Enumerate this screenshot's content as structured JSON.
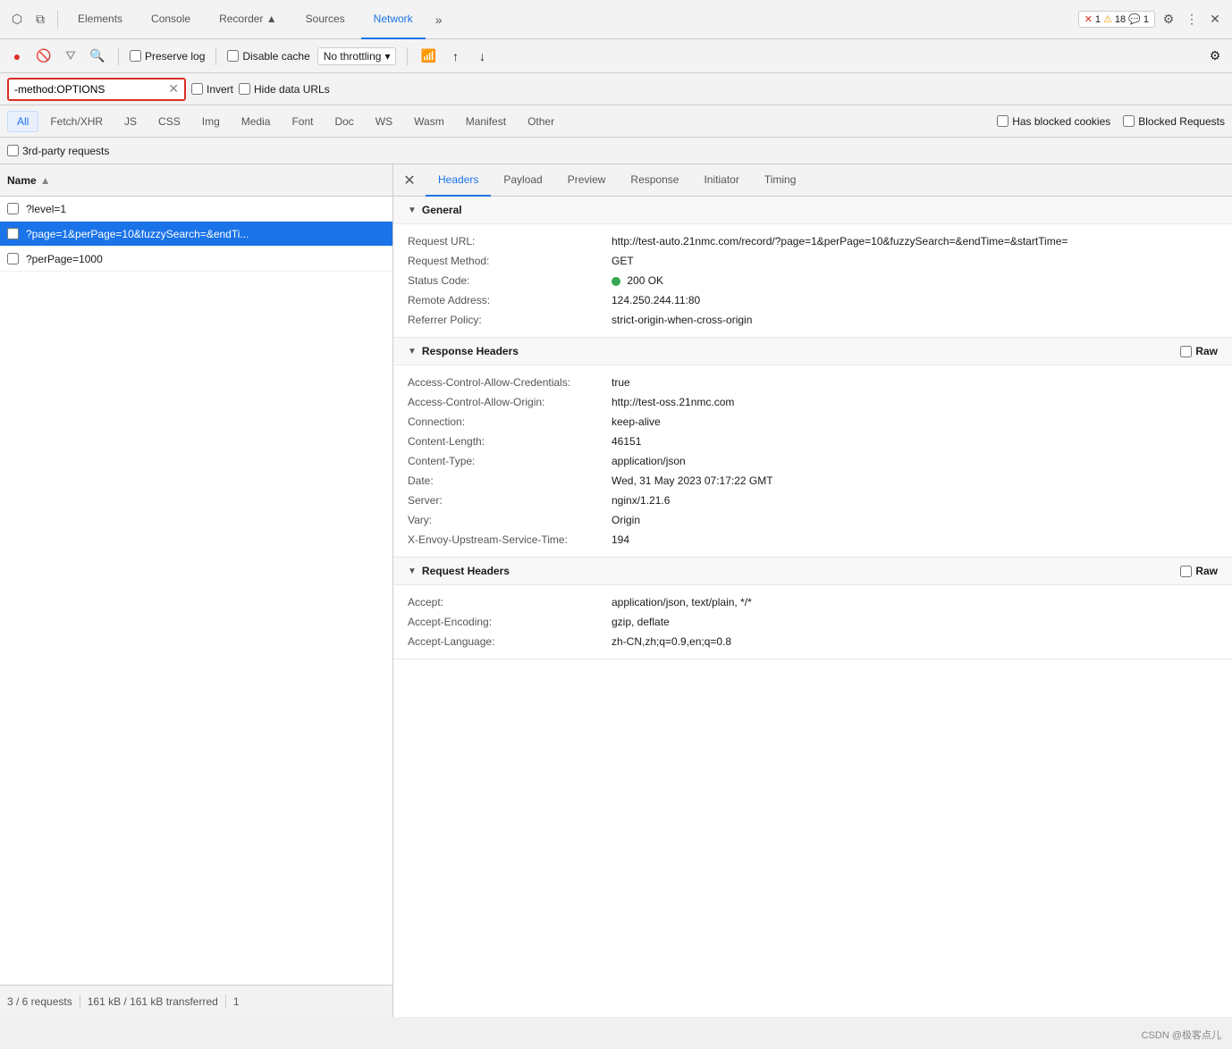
{
  "topbar": {
    "tabs": [
      {
        "label": "Elements",
        "active": false
      },
      {
        "label": "Console",
        "active": false
      },
      {
        "label": "Recorder ▲",
        "active": false
      },
      {
        "label": "Sources",
        "active": false
      },
      {
        "label": "Network",
        "active": true
      }
    ],
    "more_label": "»",
    "error_count": "1",
    "warn_count": "18",
    "info_count": "1",
    "settings_icon": "⚙",
    "more_icon": "⋮",
    "close_icon": "✕"
  },
  "toolbar": {
    "record_icon": "●",
    "clear_icon": "🚫",
    "filter_icon": "▼",
    "search_icon": "🔍",
    "preserve_log_label": "Preserve log",
    "disable_cache_label": "Disable cache",
    "throttle_label": "No throttling",
    "wifi_icon": "wifi",
    "upload_icon": "↑",
    "download_icon": "↓",
    "settings_icon": "⚙"
  },
  "filterbar": {
    "search_value": "-method:OPTIONS",
    "invert_label": "Invert",
    "hide_data_urls_label": "Hide data URLs"
  },
  "filter_tabs": [
    {
      "label": "All",
      "active": true
    },
    {
      "label": "Fetch/XHR",
      "active": false
    },
    {
      "label": "JS",
      "active": false
    },
    {
      "label": "CSS",
      "active": false
    },
    {
      "label": "Img",
      "active": false
    },
    {
      "label": "Media",
      "active": false
    },
    {
      "label": "Font",
      "active": false
    },
    {
      "label": "Doc",
      "active": false
    },
    {
      "label": "WS",
      "active": false
    },
    {
      "label": "Wasm",
      "active": false
    },
    {
      "label": "Manifest",
      "active": false
    },
    {
      "label": "Other",
      "active": false
    }
  ],
  "filter_checkboxes": [
    {
      "label": "Has blocked cookies"
    },
    {
      "label": "Blocked Requests"
    }
  ],
  "third_party_label": "3rd-party requests",
  "name_column": "Name",
  "requests": [
    {
      "name": "?level=1",
      "selected": false
    },
    {
      "name": "?page=1&perPage=10&fuzzySearch=&endTi...",
      "selected": true
    },
    {
      "name": "?perPage=1000",
      "selected": false
    }
  ],
  "status_bar": {
    "count": "3 / 6 requests",
    "size": "161 kB / 161 kB transferred",
    "page": "1"
  },
  "panel_tabs": [
    {
      "label": "Headers",
      "active": true
    },
    {
      "label": "Payload",
      "active": false
    },
    {
      "label": "Preview",
      "active": false
    },
    {
      "label": "Response",
      "active": false
    },
    {
      "label": "Initiator",
      "active": false
    },
    {
      "label": "Timing",
      "active": false
    }
  ],
  "sections": {
    "general": {
      "title": "General",
      "fields": [
        {
          "label": "Request URL:",
          "value": "http://test-auto.21nmc.com/record/?page=1&perPage=10&fuzzySearch=&endTime=&startTime="
        },
        {
          "label": "Request Method:",
          "value": "GET"
        },
        {
          "label": "Status Code:",
          "value": "200 OK",
          "has_dot": true
        },
        {
          "label": "Remote Address:",
          "value": "124.250.244.11:80"
        },
        {
          "label": "Referrer Policy:",
          "value": "strict-origin-when-cross-origin"
        }
      ]
    },
    "response_headers": {
      "title": "Response Headers",
      "fields": [
        {
          "label": "Access-Control-Allow-Credentials:",
          "value": "true"
        },
        {
          "label": "Access-Control-Allow-Origin:",
          "value": "http://test-oss.21nmc.com"
        },
        {
          "label": "Connection:",
          "value": "keep-alive"
        },
        {
          "label": "Content-Length:",
          "value": "46151"
        },
        {
          "label": "Content-Type:",
          "value": "application/json"
        },
        {
          "label": "Date:",
          "value": "Wed, 31 May 2023 07:17:22 GMT"
        },
        {
          "label": "Server:",
          "value": "nginx/1.21.6"
        },
        {
          "label": "Vary:",
          "value": "Origin"
        },
        {
          "label": "X-Envoy-Upstream-Service-Time:",
          "value": "194"
        }
      ]
    },
    "request_headers": {
      "title": "Request Headers",
      "fields": [
        {
          "label": "Accept:",
          "value": "application/json, text/plain, */*"
        },
        {
          "label": "Accept-Encoding:",
          "value": "gzip, deflate"
        },
        {
          "label": "Accept-Language:",
          "value": "zh-CN,zh;q=0.9,en;q=0.8"
        }
      ]
    }
  },
  "watermark": "CSDN @极客点儿"
}
